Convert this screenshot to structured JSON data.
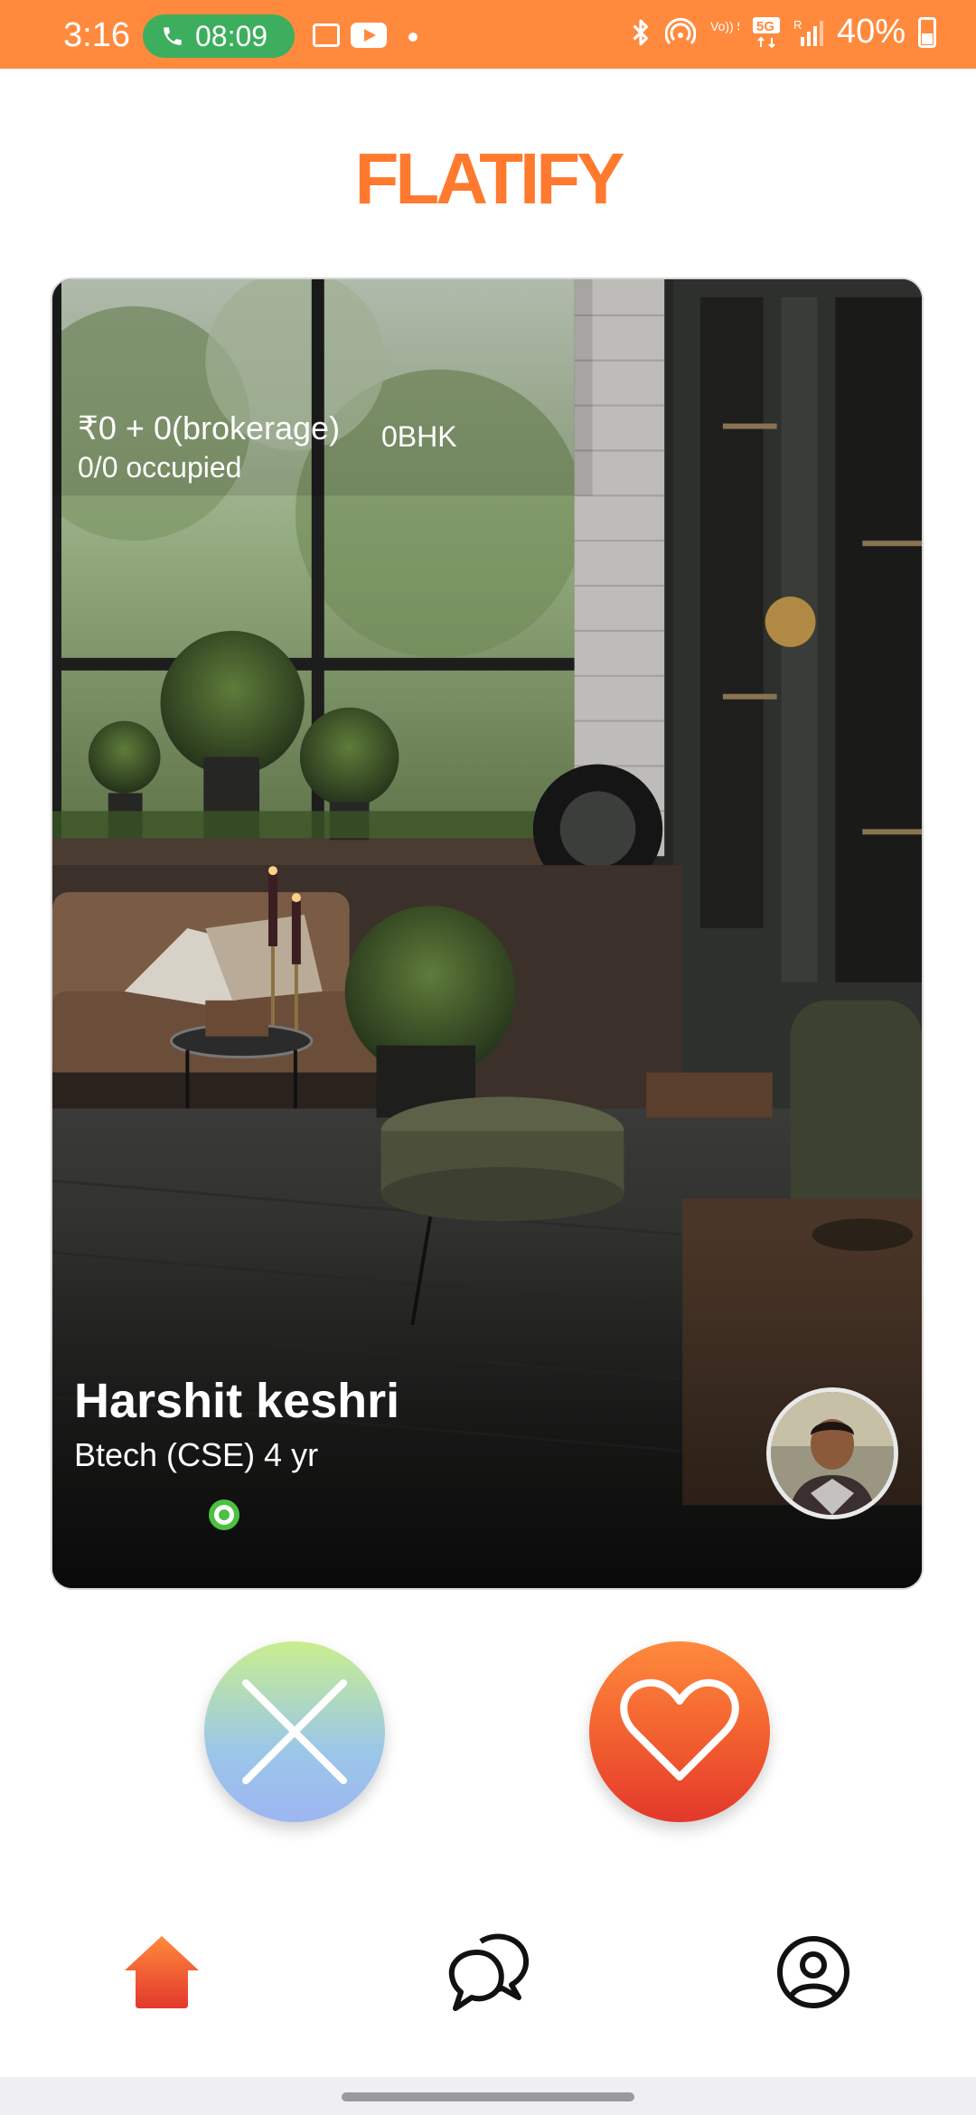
{
  "status_bar": {
    "time": "3:16",
    "call_timer": "08:09",
    "battery": "40%",
    "icons": [
      "phone-icon",
      "gallery-icon",
      "youtube-icon",
      "bluetooth-icon",
      "hotspot-icon",
      "volte-icon",
      "5g-icon",
      "signal-icon",
      "battery-icon"
    ],
    "signal_labels": {
      "volte": "Vo)) 5G",
      "five_g": "5G",
      "roaming": "R"
    }
  },
  "app": {
    "logo": "FLATIFY",
    "accent_color": "#FF7A2E"
  },
  "card": {
    "price": "₹0 + 0(brokerage)",
    "bhk": "0BHK",
    "occupancy": "0/0 occupied",
    "name": "Harshit keshri",
    "course_duration": "Btech (CSE)  4 yr",
    "online_status": "online"
  },
  "actions": {
    "reject_icon": "close-icon",
    "like_icon": "heart-icon",
    "reject_colors": [
      "#C9EE8E",
      "#9DB6F2"
    ],
    "like_colors": [
      "#FF8A3D",
      "#E3382C"
    ]
  },
  "bottom_nav": {
    "items": [
      {
        "icon": "home-icon",
        "active": true,
        "color": "#F05A2E"
      },
      {
        "icon": "chat-icon",
        "active": false
      },
      {
        "icon": "profile-icon",
        "active": false
      }
    ]
  }
}
